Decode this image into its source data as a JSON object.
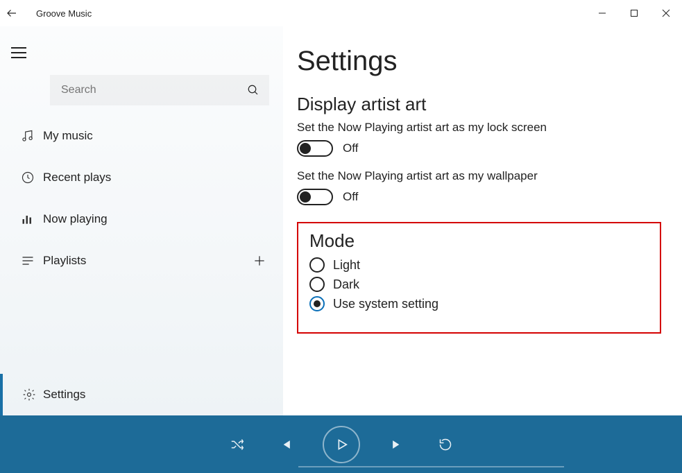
{
  "app": {
    "title": "Groove Music"
  },
  "sidebar": {
    "search_placeholder": "Search",
    "items": [
      {
        "label": "My music"
      },
      {
        "label": "Recent plays"
      },
      {
        "label": "Now playing"
      },
      {
        "label": "Playlists"
      }
    ],
    "settings_label": "Settings"
  },
  "settings": {
    "page_title": "Settings",
    "artist_art": {
      "heading": "Display artist art",
      "lockscreen_desc": "Set the Now Playing artist art as my lock screen",
      "lockscreen_state": "Off",
      "wallpaper_desc": "Set the Now Playing artist art as my wallpaper",
      "wallpaper_state": "Off"
    },
    "mode": {
      "heading": "Mode",
      "options": {
        "light": "Light",
        "dark": "Dark",
        "system": "Use system setting"
      },
      "selected": "system"
    }
  }
}
